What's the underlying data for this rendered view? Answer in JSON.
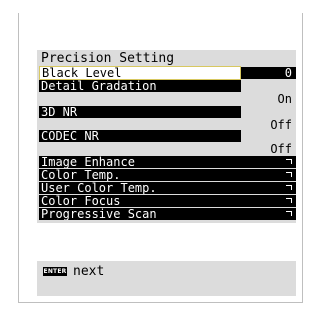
{
  "menu": {
    "title": "Precision Setting",
    "items": [
      {
        "label": "Black Level",
        "value": "0"
      },
      {
        "label": "Detail Gradation",
        "value": "On"
      },
      {
        "label": "3D NR",
        "value": "Off"
      },
      {
        "label": "CODEC NR",
        "value": "Off"
      },
      {
        "label": "Image Enhance"
      },
      {
        "label": "Color Temp."
      },
      {
        "label": "User Color Temp."
      },
      {
        "label": "Color Focus"
      },
      {
        "label": "Progressive Scan"
      }
    ]
  },
  "footer": {
    "key_label": "ENTER",
    "action_label": "next"
  },
  "colors": {
    "panel": "#dcdcdc",
    "row": "#000000",
    "selected_border": "#d8c860"
  },
  "icons": {
    "submenu": "corner-arrow-icon"
  }
}
